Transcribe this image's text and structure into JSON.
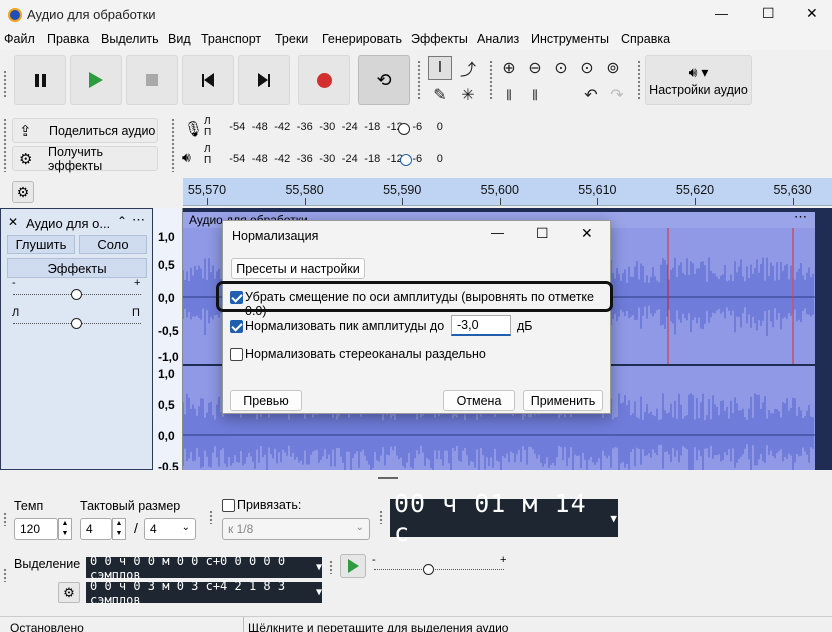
{
  "window": {
    "title": "Аудио для обработки",
    "minimize": "—",
    "maximize": "☐",
    "close": "✕"
  },
  "menu": [
    "Файл",
    "Правка",
    "Выделить",
    "Вид",
    "Транспорт",
    "Треки",
    "Генерировать",
    "Эффекты",
    "Анализ",
    "Инструменты",
    "Справка"
  ],
  "toolbar": {
    "audio_settings": "Настройки аудио",
    "share_audio": "Поделиться аудио",
    "get_effects": "Получить эффекты"
  },
  "meters": {
    "record_label": "Л\nП",
    "scale": [
      "-54",
      "-48",
      "-42",
      "-36",
      "-30",
      "-24",
      "-18",
      "-12",
      "-6",
      "0"
    ],
    "play_level": 0.72,
    "rec_level": 0.86
  },
  "ruler": {
    "ticks": [
      "55,570",
      "55,580",
      "55,590",
      "55,600",
      "55,610",
      "55,620",
      "55,630"
    ]
  },
  "track": {
    "name": "Аудио для о...",
    "mute": "Глушить",
    "solo": "Соло",
    "effects": "Эффекты",
    "gain_minus": "-",
    "gain_plus": "+",
    "pan_left": "Л",
    "pan_right": "П",
    "clip_name": "Аудио для обработки",
    "gain_level": 0.5,
    "pan_level": 0.5
  },
  "vruler": {
    "top": [
      "1,0",
      "0,5",
      "0,0",
      "-0,5",
      "-1,0"
    ],
    "bottom": [
      "1,0",
      "0,5",
      "0,0",
      "-0,5"
    ]
  },
  "dialog": {
    "title": "Нормализация",
    "presets": "Пресеты и настройки",
    "opt_dc": "Убрать смещение по оси амплитуды (выровнять по отметке 0.0)",
    "opt_peak": "Нормализовать пик амплитуды до",
    "peak_value": "-3,0",
    "peak_unit": "дБ",
    "opt_stereo": "Нормализовать стереоканалы раздельно",
    "preview": "Превью",
    "cancel": "Отмена",
    "apply": "Применить",
    "dc_checked": true,
    "peak_checked": true,
    "stereo_checked": false
  },
  "bottom": {
    "tempo_label": "Темп",
    "tempo": "120",
    "timesig_label": "Тактовый размер",
    "timesig_num": "4",
    "timesig_sep": "/",
    "timesig_den": "4",
    "snap_label": "Привязать:",
    "snap_value": "к 1/8",
    "time_display": "00 ч 01 м 14 с",
    "selection_label": "Выделение",
    "sel_start": "0 0 ч 0 0 м 0 0 с+0 0 0 0 0 сэмплов",
    "sel_end": "0 0 ч 0 3 м 0 3 с+4 2 1 8 3 сэмплов",
    "play_minus": "-",
    "play_plus": "+",
    "play_speed": 0.42
  },
  "status": {
    "left": "Остановлено",
    "right": "Щёлкните и перетащите для выделения аудио"
  },
  "colors": {
    "wave_bg": "#1f2d55",
    "wave": "#5b6ad2",
    "selection": "#8f99e6",
    "ruler": "#bfd4f2",
    "record": "#d32f2f",
    "play": "#2e9b3e"
  }
}
